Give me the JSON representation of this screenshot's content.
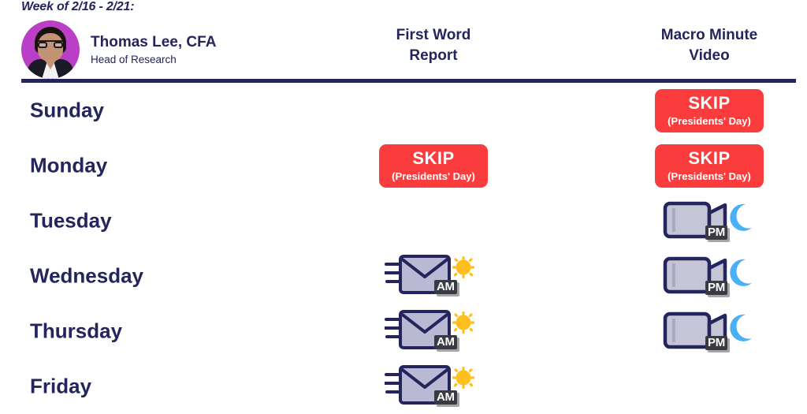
{
  "header": {
    "week_label": "Week of 2/16 - 2/21:",
    "person": {
      "name": "Thomas Lee, CFA",
      "role": "Head of Research",
      "avatar_alt": "avatar"
    },
    "columns": [
      {
        "id": "first-word-report",
        "line1": "First Word",
        "line2": "Report"
      },
      {
        "id": "macro-minute-video",
        "line1": "Macro Minute",
        "line2": "Video"
      }
    ]
  },
  "colors": {
    "navy": "#23255c",
    "skip_red": "#fa3c3c",
    "avatar_purple": "#b93fc6",
    "envelope_fill": "#b9b9d4",
    "sun_yellow": "#ffc01f",
    "moon_blue": "#4ab0f5",
    "tag_dark": "#3a3a42"
  },
  "skip": {
    "main": "SKIP",
    "sub": "(Presidents' Day)"
  },
  "icons": {
    "email_am": {
      "name": "email-am-icon",
      "tag": "AM"
    },
    "video_pm": {
      "name": "video-pm-icon",
      "tag": "PM"
    }
  },
  "rows": [
    {
      "day": "Sunday",
      "first_word": "none",
      "macro_minute": "skip"
    },
    {
      "day": "Monday",
      "first_word": "skip",
      "macro_minute": "skip"
    },
    {
      "day": "Tuesday",
      "first_word": "none",
      "macro_minute": "video_pm"
    },
    {
      "day": "Wednesday",
      "first_word": "email_am",
      "macro_minute": "video_pm"
    },
    {
      "day": "Thursday",
      "first_word": "email_am",
      "macro_minute": "video_pm"
    },
    {
      "day": "Friday",
      "first_word": "email_am",
      "macro_minute": "none"
    }
  ]
}
